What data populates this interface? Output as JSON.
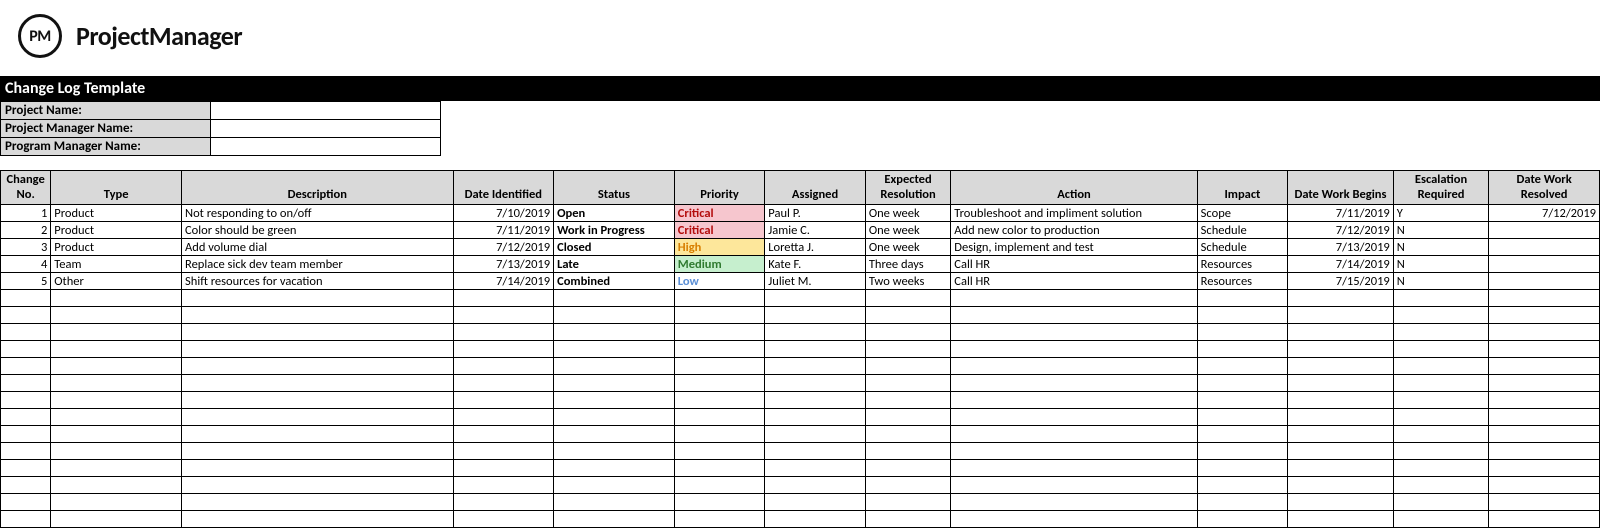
{
  "brand": {
    "logo_text": "PM",
    "name": "ProjectManager"
  },
  "title": "Change Log Template",
  "meta": {
    "project_name_label": "Project Name:",
    "project_name_value": "",
    "project_manager_label": "Project Manager Name:",
    "project_manager_value": "",
    "program_manager_label": "Program Manager Name:",
    "program_manager_value": ""
  },
  "headers": {
    "change_no": "Change No.",
    "type": "Type",
    "description": "Description",
    "date_identified": "Date Identified",
    "status": "Status",
    "priority": "Priority",
    "assigned": "Assigned",
    "expected_resolution": "Expected Resolution",
    "action": "Action",
    "impact": "Impact",
    "date_work_begins": "Date Work Begins",
    "escalation_required": "Escalation Required",
    "date_work_resolved": "Date Work Resolved"
  },
  "rows": [
    {
      "no": "1",
      "type": "Product",
      "desc": "Not responding to on/off",
      "date_id": "7/10/2019",
      "status": "Open",
      "priority": "Critical",
      "assigned": "Paul P.",
      "exp_res": "One week",
      "action": "Troubleshoot and impliment solution",
      "impact": "Scope",
      "dw_begin": "7/11/2019",
      "esc_req": "Y",
      "d_resolved": "7/12/2019"
    },
    {
      "no": "2",
      "type": "Product",
      "desc": "Color should be green",
      "date_id": "7/11/2019",
      "status": "Work in Progress",
      "priority": "Critical",
      "assigned": "Jamie C.",
      "exp_res": "One week",
      "action": "Add new color to production",
      "impact": "Schedule",
      "dw_begin": "7/12/2019",
      "esc_req": "N",
      "d_resolved": ""
    },
    {
      "no": "3",
      "type": "Product",
      "desc": "Add volume dial",
      "date_id": "7/12/2019",
      "status": "Closed",
      "priority": "High",
      "assigned": "Loretta J.",
      "exp_res": "One week",
      "action": "Design, implement and test",
      "impact": "Schedule",
      "dw_begin": "7/13/2019",
      "esc_req": "N",
      "d_resolved": ""
    },
    {
      "no": "4",
      "type": "Team",
      "desc": "Replace sick dev team member",
      "date_id": "7/13/2019",
      "status": "Late",
      "priority": "Medium",
      "assigned": "Kate F.",
      "exp_res": "Three days",
      "action": "Call HR",
      "impact": "Resources",
      "dw_begin": "7/14/2019",
      "esc_req": "N",
      "d_resolved": ""
    },
    {
      "no": "5",
      "type": "Other",
      "desc": "Shift resources for vacation",
      "date_id": "7/14/2019",
      "status": "Combined",
      "priority": "Low",
      "assigned": "Juliet M.",
      "exp_res": "Two weeks",
      "action": "Call HR",
      "impact": "Resources",
      "dw_begin": "7/15/2019",
      "esc_req": "N",
      "d_resolved": ""
    }
  ],
  "empty_row_count": 14,
  "priority_class": {
    "Critical": "p-critical",
    "High": "p-high",
    "Medium": "p-medium",
    "Low": "p-low"
  }
}
